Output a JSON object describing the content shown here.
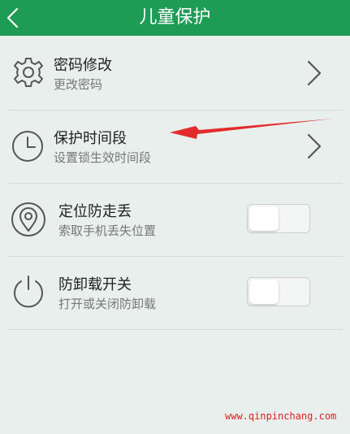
{
  "header": {
    "title": "儿童保护",
    "back_icon": "chevron-left-icon",
    "background_color": "#1e9c55"
  },
  "rows": [
    {
      "title": "密码修改",
      "subtitle": "更改密码",
      "icon": "gear-icon",
      "control": "chevron"
    },
    {
      "title": "保护时间段",
      "subtitle": "设置锁生效时间段",
      "icon": "clock-icon",
      "control": "chevron"
    },
    {
      "title": "定位防走丢",
      "subtitle": "索取手机丢失位置",
      "icon": "location-pin-icon",
      "control": "toggle",
      "enabled": false
    },
    {
      "title": "防卸载开关",
      "subtitle": "打开或关闭防卸载",
      "icon": "power-icon",
      "control": "toggle",
      "enabled": false
    }
  ],
  "annotation": {
    "type": "red-arrow",
    "points_to": "保护时间段",
    "color": "#e32b2b"
  },
  "watermark": "www.qinpinchang.com"
}
